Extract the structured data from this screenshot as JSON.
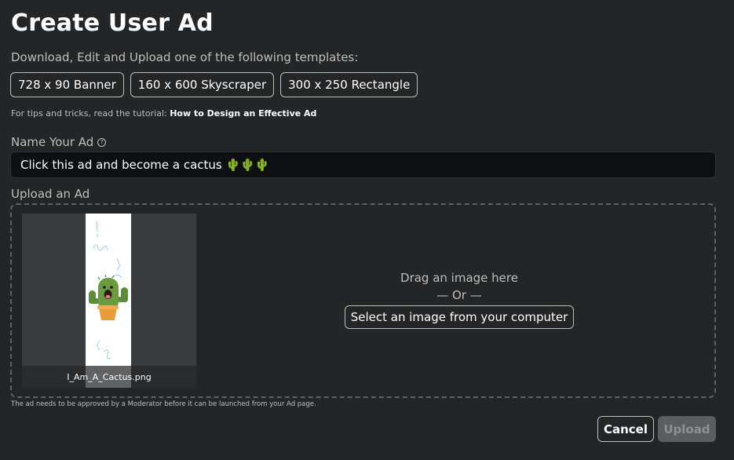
{
  "page": {
    "title": "Create User Ad",
    "subtitle": "Download, Edit and Upload one of the following templates:"
  },
  "templates": [
    {
      "label": "728 x 90 Banner"
    },
    {
      "label": "160 x 600 Skyscraper"
    },
    {
      "label": "300 x 250 Rectangle"
    }
  ],
  "tips": {
    "prefix": "For tips and tricks, read the tutorial:",
    "link_label": "How to Design an Effective Ad"
  },
  "name_field": {
    "label": "Name Your Ad",
    "help_icon": "question-circle-icon",
    "value": "Click this ad and become a cactus 🌵🌵🌵"
  },
  "upload": {
    "label": "Upload an Ad",
    "file_name": "I_Am_A_Cactus.png",
    "drag_text": "Drag an image here",
    "or_text": "— Or —",
    "select_label": "Select an image from your computer",
    "approval_note": "The ad needs to be approved by a Moderator before it can be launched from your Ad page."
  },
  "actions": {
    "cancel_label": "Cancel",
    "upload_label": "Upload"
  },
  "colors": {
    "background": "#232527",
    "input_background": "#0e0f10",
    "cactus_green": "#5f8a3a",
    "pot_orange": "#e79b3b",
    "scribble_blue": "#8fd4e6"
  }
}
